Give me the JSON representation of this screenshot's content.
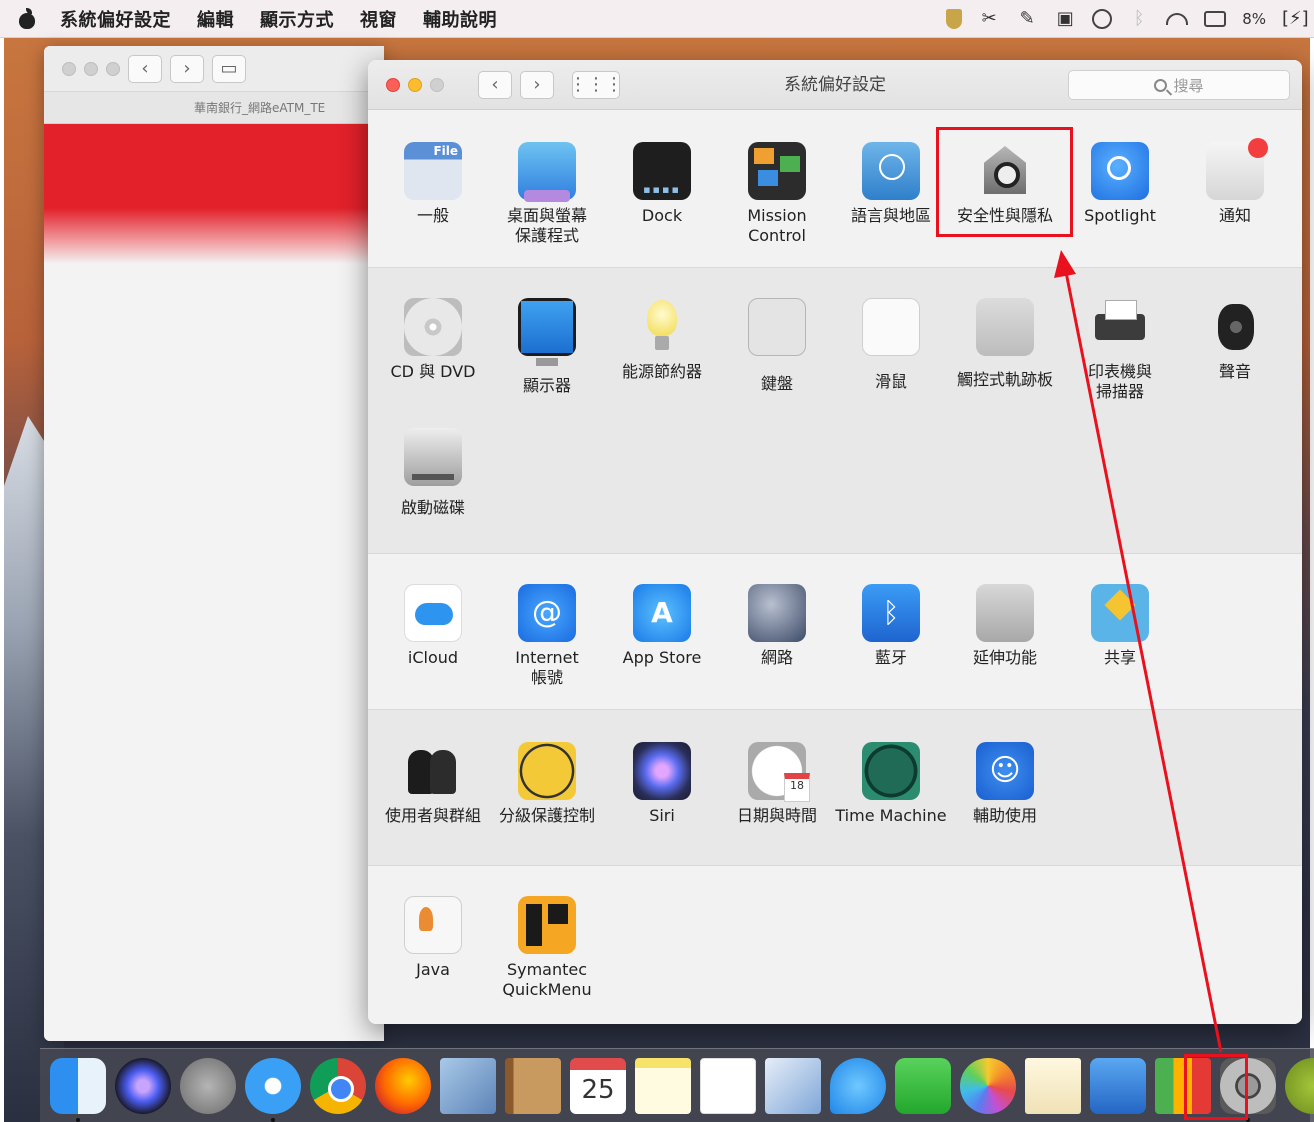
{
  "menubar": {
    "app_name": "系統偏好設定",
    "items": [
      "編輯",
      "顯示方式",
      "視窗",
      "輔助說明"
    ],
    "battery": "8%"
  },
  "background_window": {
    "tab_title": "華南銀行_網路eATM_TE"
  },
  "prefwindow": {
    "title": "系統偏好設定",
    "search_placeholder": "搜尋"
  },
  "panes": {
    "row1": [
      {
        "label": "一般",
        "icon": "general-icon"
      },
      {
        "label": "桌面與螢幕\n保護程式",
        "icon": "desktop-screensaver-icon"
      },
      {
        "label": "Dock",
        "icon": "dock-icon"
      },
      {
        "label": "Mission\nControl",
        "icon": "mission-control-icon"
      },
      {
        "label": "語言與地區",
        "icon": "language-region-icon"
      },
      {
        "label": "安全性與隱私",
        "icon": "security-privacy-icon"
      },
      {
        "label": "Spotlight",
        "icon": "spotlight-icon"
      },
      {
        "label": "通知",
        "icon": "notifications-icon"
      }
    ],
    "row2": [
      {
        "label": "CD 與 DVD",
        "icon": "cd-dvd-icon"
      },
      {
        "label": "顯示器",
        "icon": "displays-icon"
      },
      {
        "label": "能源節約器",
        "icon": "energy-saver-icon"
      },
      {
        "label": "鍵盤",
        "icon": "keyboard-icon"
      },
      {
        "label": "滑鼠",
        "icon": "mouse-icon"
      },
      {
        "label": "觸控式軌跡板",
        "icon": "trackpad-icon"
      },
      {
        "label": "印表機與\n掃描器",
        "icon": "printer-scanner-icon"
      },
      {
        "label": "聲音",
        "icon": "sound-icon"
      },
      {
        "label": "啟動磁碟",
        "icon": "startup-disk-icon"
      }
    ],
    "row3": [
      {
        "label": "iCloud",
        "icon": "icloud-icon"
      },
      {
        "label": "Internet\n帳號",
        "icon": "internet-accounts-icon"
      },
      {
        "label": "App Store",
        "icon": "app-store-icon"
      },
      {
        "label": "網路",
        "icon": "network-icon"
      },
      {
        "label": "藍牙",
        "icon": "bluetooth-icon"
      },
      {
        "label": "延伸功能",
        "icon": "extensions-icon"
      },
      {
        "label": "共享",
        "icon": "sharing-icon"
      }
    ],
    "row4": [
      {
        "label": "使用者與群組",
        "icon": "users-groups-icon"
      },
      {
        "label": "分級保護控制",
        "icon": "parental-controls-icon"
      },
      {
        "label": "Siri",
        "icon": "siri-icon"
      },
      {
        "label": "日期與時間",
        "icon": "date-time-icon"
      },
      {
        "label": "Time Machine",
        "icon": "time-machine-icon"
      },
      {
        "label": "輔助使用",
        "icon": "accessibility-icon"
      }
    ],
    "row5": [
      {
        "label": "Java",
        "icon": "java-icon"
      },
      {
        "label": "Symantec\nQuickMenu",
        "icon": "symantec-quickmenu-icon"
      }
    ]
  },
  "dock": {
    "calendar_day": "25",
    "apps": [
      "finder-icon",
      "siri-icon",
      "launchpad-icon",
      "safari-icon",
      "chrome-icon",
      "firefox-icon",
      "mail-icon",
      "contacts-icon",
      "calendar-icon",
      "notes-icon",
      "reminders-icon",
      "preview-icon",
      "messages-icon",
      "facetime-icon",
      "photos-icon",
      "textedit-icon",
      "keynote-icon",
      "numbers-icon",
      "system-preferences-icon",
      "android-studio-icon"
    ]
  },
  "annotation": {
    "color": "#e8111d",
    "highlighted_pane": "安全性與隱私",
    "highlighted_dock_app": "system-preferences-icon"
  }
}
